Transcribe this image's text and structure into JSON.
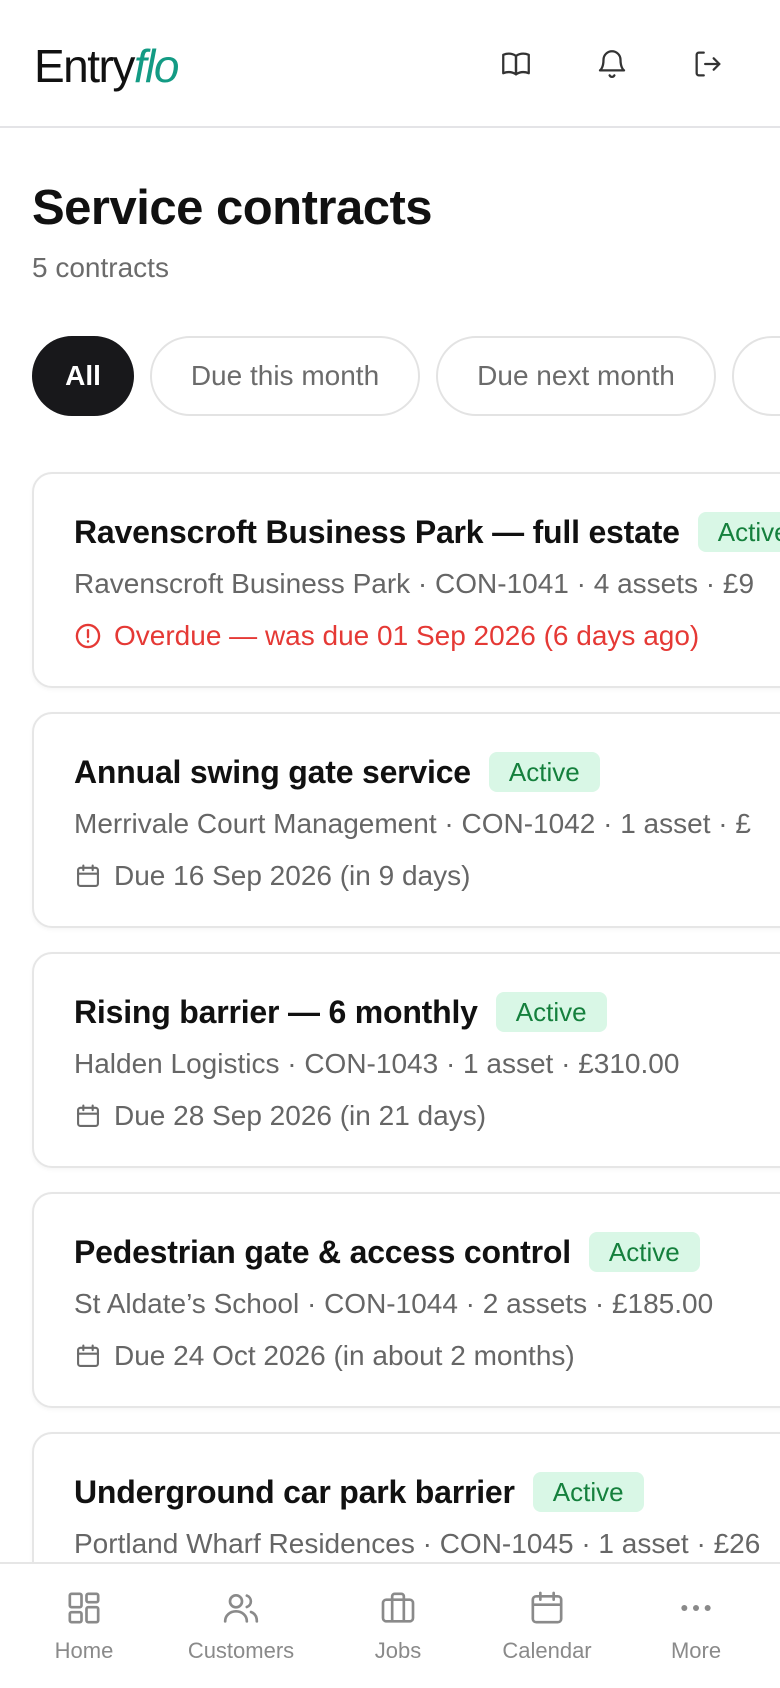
{
  "app": {
    "logo_part1": "Entry",
    "logo_part2": "flo",
    "accent_color": "#139b84"
  },
  "header_icons": [
    "book-icon",
    "bell-icon",
    "logout-icon"
  ],
  "page": {
    "title": "Service contracts",
    "subtitle": "5 contracts"
  },
  "filters": [
    {
      "label": "All",
      "active": true
    },
    {
      "label": "Due this month",
      "active": false
    },
    {
      "label": "Due next month",
      "active": false
    }
  ],
  "contracts": [
    {
      "title": "Ravenscroft Business Park — full estate",
      "status": "Active",
      "meta": "Ravenscroft Business Park · CON-1041 · 4 assets · £9",
      "due": "Overdue — was due 01 Sep 2026 (6 days ago)",
      "overdue": true
    },
    {
      "title": "Annual swing gate service",
      "status": "Active",
      "meta": "Merrivale Court Management · CON-1042 · 1 asset · £",
      "due": "Due 16 Sep 2026 (in 9 days)",
      "overdue": false
    },
    {
      "title": "Rising barrier — 6 monthly",
      "status": "Active",
      "meta": "Halden Logistics · CON-1043 · 1 asset · £310.00",
      "due": "Due 28 Sep 2026 (in 21 days)",
      "overdue": false
    },
    {
      "title": "Pedestrian gate & access control",
      "status": "Active",
      "meta": "St Aldate’s School · CON-1044 · 2 assets · £185.00",
      "due": "Due 24 Oct 2026 (in about 2 months)",
      "overdue": false
    },
    {
      "title": "Underground car park barrier",
      "status": "Active",
      "meta": "Portland Wharf Residences · CON-1045 · 1 asset · £26",
      "due": "",
      "overdue": false
    }
  ],
  "colors": {
    "overdue": "#e53935",
    "badge_bg": "#d9f7e6",
    "badge_text": "#15803d"
  },
  "bottom_nav": [
    {
      "label": "Home",
      "icon": "grid-icon"
    },
    {
      "label": "Customers",
      "icon": "users-icon"
    },
    {
      "label": "Jobs",
      "icon": "briefcase-icon"
    },
    {
      "label": "Calendar",
      "icon": "calendar-icon"
    },
    {
      "label": "More",
      "icon": "more-icon"
    }
  ]
}
